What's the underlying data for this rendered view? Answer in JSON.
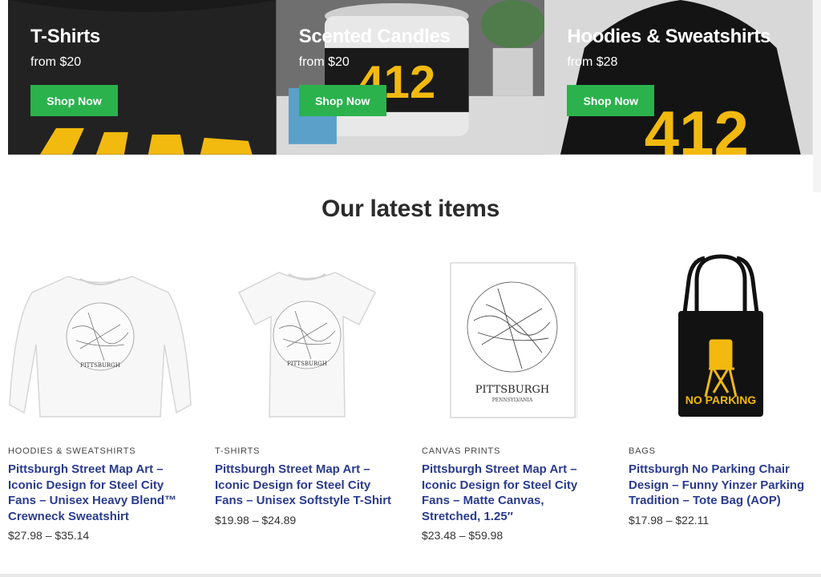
{
  "banners": [
    {
      "title": "T-Shirts",
      "from": "from $20",
      "button": "Shop Now"
    },
    {
      "title": "Scented Candles",
      "from": "from $20",
      "button": "Shop Now"
    },
    {
      "title": "Hoodies & Sweatshirts",
      "from": "from $28",
      "button": "Shop Now"
    }
  ],
  "banner_art": {
    "candle_text": "412",
    "hoodie_text": "412"
  },
  "section_title": "Our latest items",
  "products": [
    {
      "category": "HOODIES & SWEATSHIRTS",
      "title": "Pittsburgh Street Map Art – Iconic Design for Steel City Fans – Unisex Heavy Blend™ Crewneck Sweatshirt",
      "price": "$27.98 – $35.14",
      "art_text": "PITTSBURGH"
    },
    {
      "category": "T-SHIRTS",
      "title": "Pittsburgh Street Map Art – Iconic Design for Steel City Fans – Unisex Softstyle T-Shirt",
      "price": "$19.98 – $24.89",
      "art_text": "PITTSBURGH"
    },
    {
      "category": "CANVAS PRINTS",
      "title": "Pittsburgh Street Map Art – Iconic Design for Steel City Fans – Matte Canvas, Stretched, 1.25″",
      "price": "$23.48 – $59.98",
      "art_text": "PITTSBURGH",
      "art_subtext": "PENNSYLVANIA"
    },
    {
      "category": "BAGS",
      "title": "Pittsburgh No Parking Chair Design – Funny Yinzer Parking Tradition – Tote Bag (AOP)",
      "price": "$17.98 – $22.11",
      "art_text": "NO PARKING"
    }
  ],
  "colors": {
    "accent_button": "#2bb24c",
    "product_title": "#2a3b8f",
    "steelers_gold": "#f2b90f"
  }
}
